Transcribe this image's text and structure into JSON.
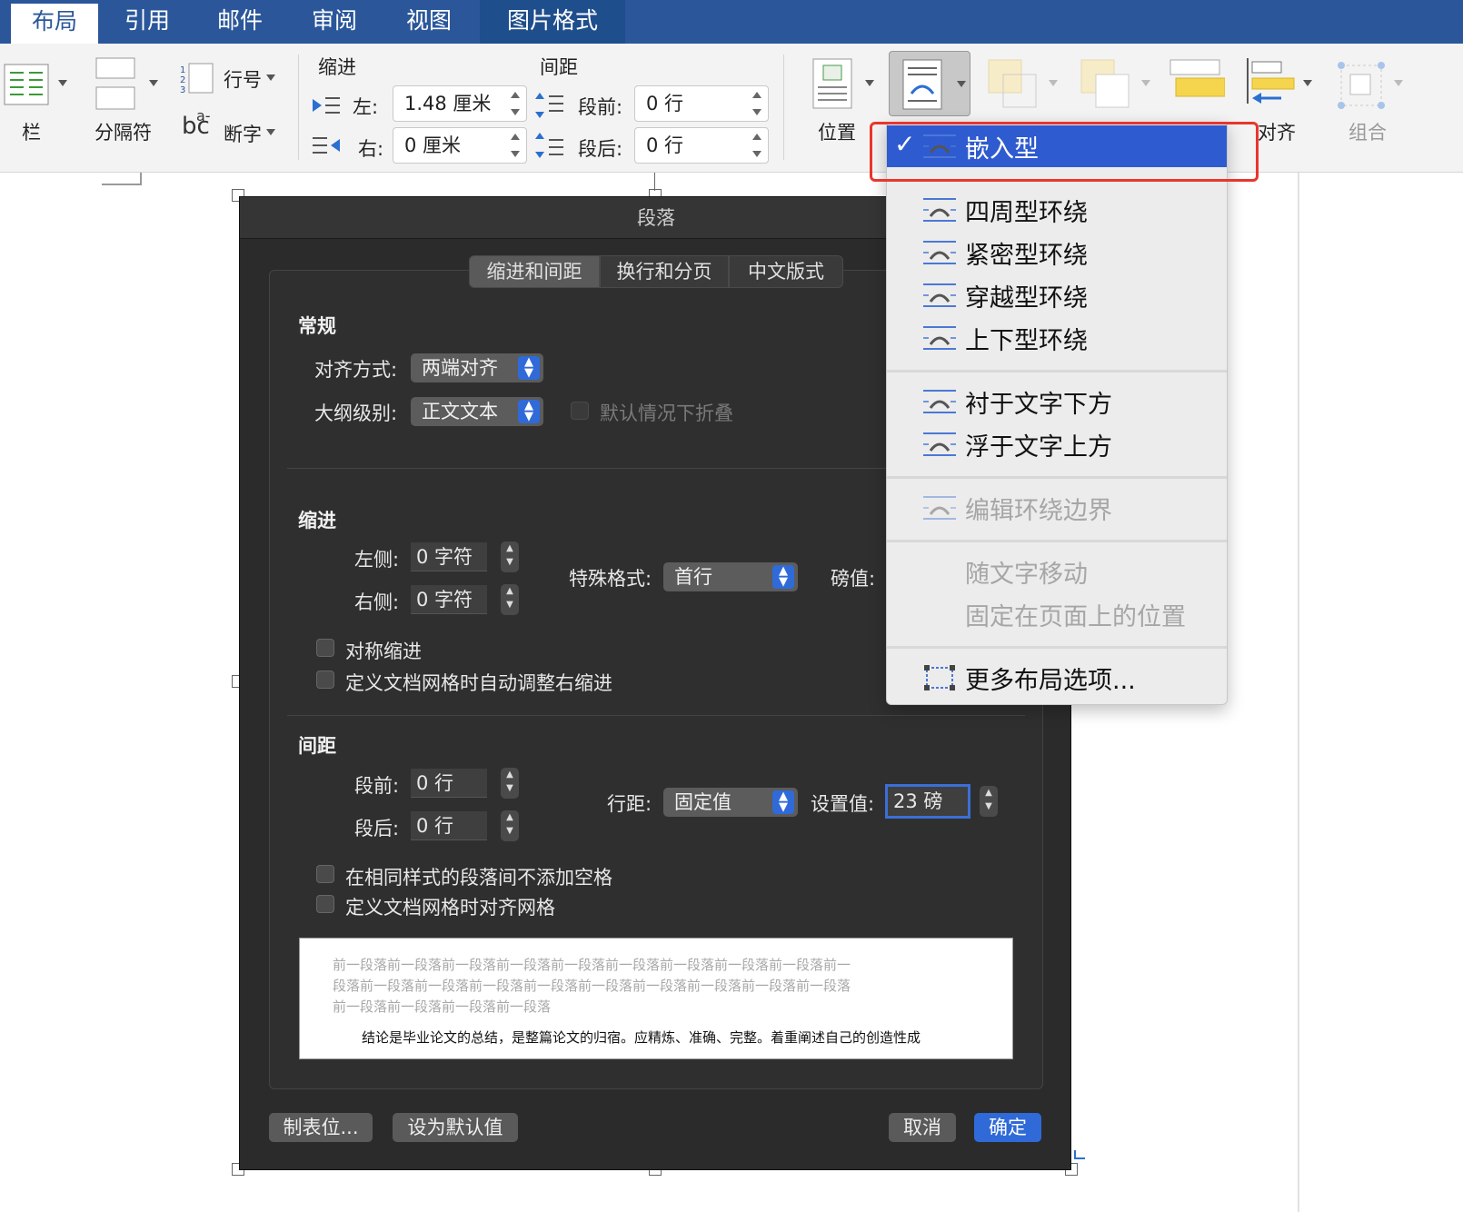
{
  "tabs": [
    {
      "label": "布局",
      "active": true
    },
    {
      "label": "引用"
    },
    {
      "label": "邮件"
    },
    {
      "label": "审阅"
    },
    {
      "label": "视图"
    },
    {
      "label": "图片格式",
      "contextual": true
    }
  ],
  "ribbon": {
    "columns_label": "栏",
    "breaks_label": "分隔符",
    "line_numbers_label": "行号",
    "hyphenation_label": "断字",
    "indent_group": "缩进",
    "spacing_group": "间距",
    "indent_left_label": "左:",
    "indent_left_value": "1.48 厘米",
    "indent_right_label": "右:",
    "indent_right_value": "0 厘米",
    "spacing_before_label": "段前:",
    "spacing_before_value": "0 行",
    "spacing_after_label": "段后:",
    "spacing_after_value": "0 行",
    "position_label": "位置",
    "align_label": "对齐",
    "group_label": "组合"
  },
  "dialog": {
    "title": "段落",
    "tabs": [
      "缩进和间距",
      "换行和分页",
      "中文版式"
    ],
    "general_heading": "常规",
    "alignment_label": "对齐方式:",
    "alignment_value": "两端对齐",
    "outline_label": "大纲级别:",
    "outline_value": "正文文本",
    "collapse_label": "默认情况下折叠",
    "indent_heading": "缩进",
    "left_label": "左侧:",
    "left_value": "0 字符",
    "right_label": "右侧:",
    "right_value": "0 字符",
    "special_label": "特殊格式:",
    "special_value": "首行",
    "by_label": "磅值:",
    "mirror_label": "对称缩进",
    "auto_right_label": "定义文档网格时自动调整右缩进",
    "spacing_heading": "间距",
    "before_label": "段前:",
    "before_value": "0 行",
    "after_label": "段后:",
    "after_value": "0 行",
    "line_spacing_label": "行距:",
    "line_spacing_value": "固定值",
    "at_label": "设置值:",
    "at_value": "23 磅",
    "no_space_label": "在相同样式的段落间不添加空格",
    "snap_grid_label": "定义文档网格时对齐网格",
    "preview_prev_lines": [
      "前一段落前一段落前一段落前一段落前一段落前一段落前一段落前一段落前一段落前一",
      "段落前一段落前一段落前一段落前一段落前一段落前一段落前一段落前一段落前一段落",
      "前一段落前一段落前一段落前一段落"
    ],
    "preview_text": "结论是毕业论文的总结，是整篇论文的归宿。应精炼、准确、完整。着重阐述自己的创造性成",
    "tabs_button": "制表位...",
    "default_button": "设为默认值",
    "cancel_button": "取消",
    "ok_button": "确定"
  },
  "wrap_menu": {
    "inline": "嵌入型",
    "square": "四周型环绕",
    "tight": "紧密型环绕",
    "through": "穿越型环绕",
    "top_bottom": "上下型环绕",
    "behind": "衬于文字下方",
    "in_front": "浮于文字上方",
    "edit_points": "编辑环绕边界",
    "move_with_text": "随文字移动",
    "fix_position": "固定在页面上的位置",
    "more_options": "更多布局选项..."
  },
  "colors": {
    "tab_bar": "#2b579a",
    "menu_selected": "#2f5bd0",
    "highlight": "#e8362d",
    "dialog_bg": "#2b2b2b",
    "primary_button": "#2f6ad8"
  }
}
